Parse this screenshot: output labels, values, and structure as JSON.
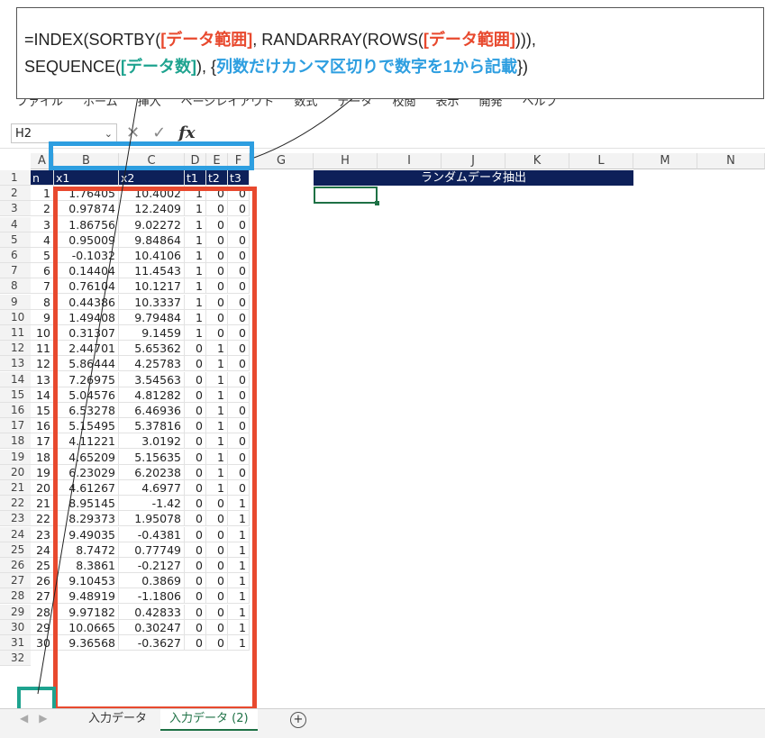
{
  "callout": {
    "line1_a": "=INDEX(SORTBY(",
    "line1_b": "[データ範囲]",
    "line1_c": ", RANDARRAY(ROWS(",
    "line1_d": "[データ範囲]",
    "line1_e": "))),",
    "line2_a": "SEQUENCE(",
    "line2_b": "[データ数]",
    "line2_c": "), {",
    "line2_d": "列数だけカンマ区切りで数字を1から記載",
    "line2_e": "})"
  },
  "menu": [
    "ファイル",
    "ホーム",
    "挿入",
    "ページレイアウト",
    "数式",
    "データ",
    "校閲",
    "表示",
    "開発",
    "ヘルプ"
  ],
  "namebox": "H2",
  "fx": "fx",
  "columns": [
    "A",
    "B",
    "C",
    "D",
    "E",
    "F",
    "G",
    "H",
    "I",
    "J",
    "K",
    "L",
    "M",
    "N"
  ],
  "headers": [
    "n",
    "x1",
    "x2",
    "t1",
    "t2",
    "t3"
  ],
  "random_title": "ランダムデータ抽出",
  "rows": [
    [
      "1",
      "1.76405",
      "10.4002",
      "1",
      "0",
      "0"
    ],
    [
      "2",
      "0.97874",
      "12.2409",
      "1",
      "0",
      "0"
    ],
    [
      "3",
      "1.86756",
      "9.02272",
      "1",
      "0",
      "0"
    ],
    [
      "4",
      "0.95009",
      "9.84864",
      "1",
      "0",
      "0"
    ],
    [
      "5",
      "-0.1032",
      "10.4106",
      "1",
      "0",
      "0"
    ],
    [
      "6",
      "0.14404",
      "11.4543",
      "1",
      "0",
      "0"
    ],
    [
      "7",
      "0.76104",
      "10.1217",
      "1",
      "0",
      "0"
    ],
    [
      "8",
      "0.44386",
      "10.3337",
      "1",
      "0",
      "0"
    ],
    [
      "9",
      "1.49408",
      "9.79484",
      "1",
      "0",
      "0"
    ],
    [
      "10",
      "0.31307",
      "9.1459",
      "1",
      "0",
      "0"
    ],
    [
      "11",
      "2.44701",
      "5.65362",
      "0",
      "1",
      "0"
    ],
    [
      "12",
      "5.86444",
      "4.25783",
      "0",
      "1",
      "0"
    ],
    [
      "13",
      "7.26975",
      "3.54563",
      "0",
      "1",
      "0"
    ],
    [
      "14",
      "5.04576",
      "4.81282",
      "0",
      "1",
      "0"
    ],
    [
      "15",
      "6.53278",
      "6.46936",
      "0",
      "1",
      "0"
    ],
    [
      "16",
      "5.15495",
      "5.37816",
      "0",
      "1",
      "0"
    ],
    [
      "17",
      "4.11221",
      "3.0192",
      "0",
      "1",
      "0"
    ],
    [
      "18",
      "4.65209",
      "5.15635",
      "0",
      "1",
      "0"
    ],
    [
      "19",
      "6.23029",
      "6.20238",
      "0",
      "1",
      "0"
    ],
    [
      "20",
      "4.61267",
      "4.6977",
      "0",
      "1",
      "0"
    ],
    [
      "21",
      "8.95145",
      "-1.42",
      "0",
      "0",
      "1"
    ],
    [
      "22",
      "8.29373",
      "1.95078",
      "0",
      "0",
      "1"
    ],
    [
      "23",
      "9.49035",
      "-0.4381",
      "0",
      "0",
      "1"
    ],
    [
      "24",
      "8.7472",
      "0.77749",
      "0",
      "0",
      "1"
    ],
    [
      "25",
      "8.3861",
      "-0.2127",
      "0",
      "0",
      "1"
    ],
    [
      "26",
      "9.10453",
      "0.3869",
      "0",
      "0",
      "1"
    ],
    [
      "27",
      "9.48919",
      "-1.1806",
      "0",
      "0",
      "1"
    ],
    [
      "28",
      "9.97182",
      "0.42833",
      "0",
      "0",
      "1"
    ],
    [
      "29",
      "10.0665",
      "0.30247",
      "0",
      "0",
      "1"
    ],
    [
      "30",
      "9.36568",
      "-0.3627",
      "0",
      "0",
      "1"
    ]
  ],
  "sheet_tabs": [
    "入力データ",
    "入力データ (2)"
  ],
  "colors": {
    "header_bg": "#0d2059",
    "red": "#e8492e",
    "blue": "#2d9ee0",
    "teal": "#1ea38f",
    "selection": "#1e7145"
  }
}
